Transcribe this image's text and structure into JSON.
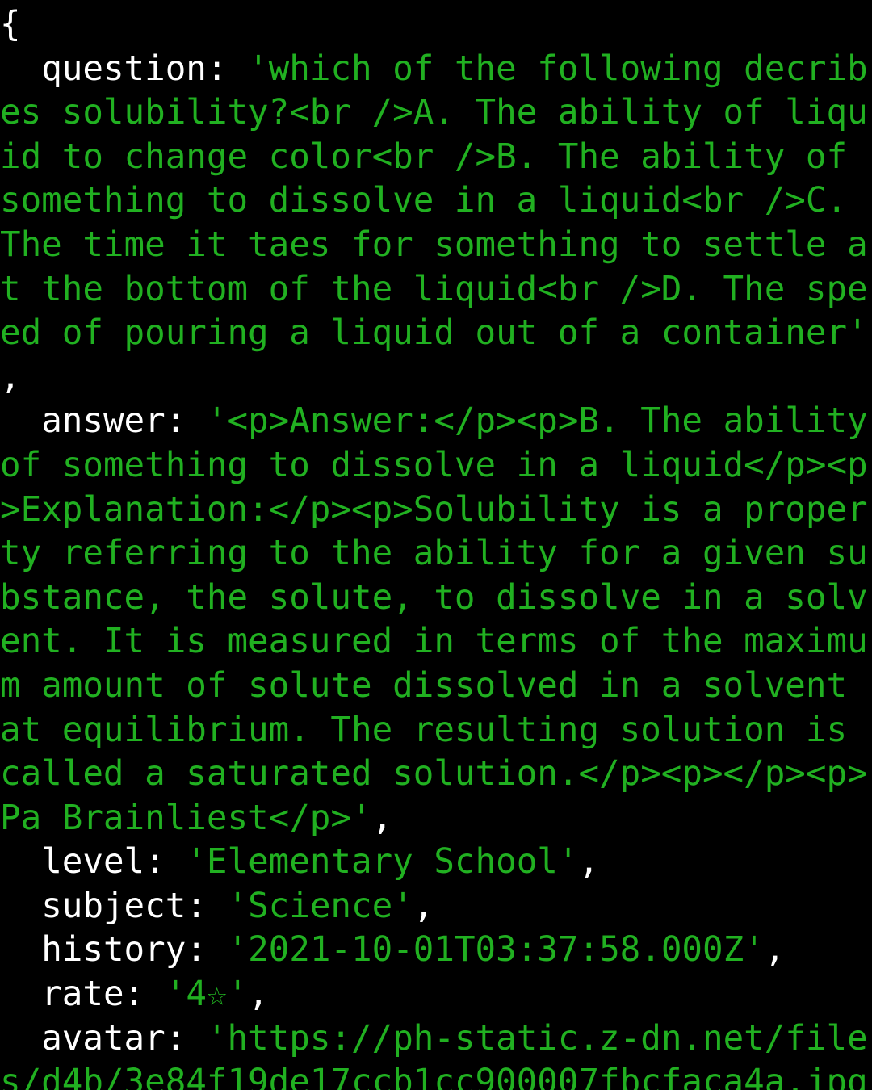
{
  "theme": {
    "background": "#000000",
    "key_color": "#ffffff",
    "string_color": "#21b021"
  },
  "record": {
    "open_brace": "{",
    "question": {
      "key": "question",
      "value": "'which of the following decribes solubility?<br />A. The ability of liquid to change color<br />B. The ability of something to dissolve in a liquid<br />C. The time it taes for something to settle at the bottom of the liquid<br />D. The speed of pouring a liquid out of a container'"
    },
    "answer": {
      "key": "answer",
      "value": "'<p>Answer:</p><p>B. The ability of something to dissolve in a liquid</p><p>Explanation:</p><p>Solubility is a property referring to the ability for a given substance, the solute, to dissolve in a solvent. It is measured in terms of the maximum amount of solute dissolved in a solvent at equilibrium. The resulting solution is called a saturated solution.</p><p></p><p>Pa Brainliest</p>'"
    },
    "level": {
      "key": "level",
      "value": "'Elementary School'"
    },
    "subject": {
      "key": "subject",
      "value": "'Science'"
    },
    "history": {
      "key": "history",
      "value": "'2021-10-01T03:37:58.000Z'"
    },
    "rate": {
      "key": "rate",
      "value": "'4☆'"
    },
    "avatar": {
      "key": "avatar",
      "value": "'https://ph-static.z-dn.net/files/d4b/3e84f19de17ccb1cc900007fbcfaca4a.jpg"
    }
  }
}
